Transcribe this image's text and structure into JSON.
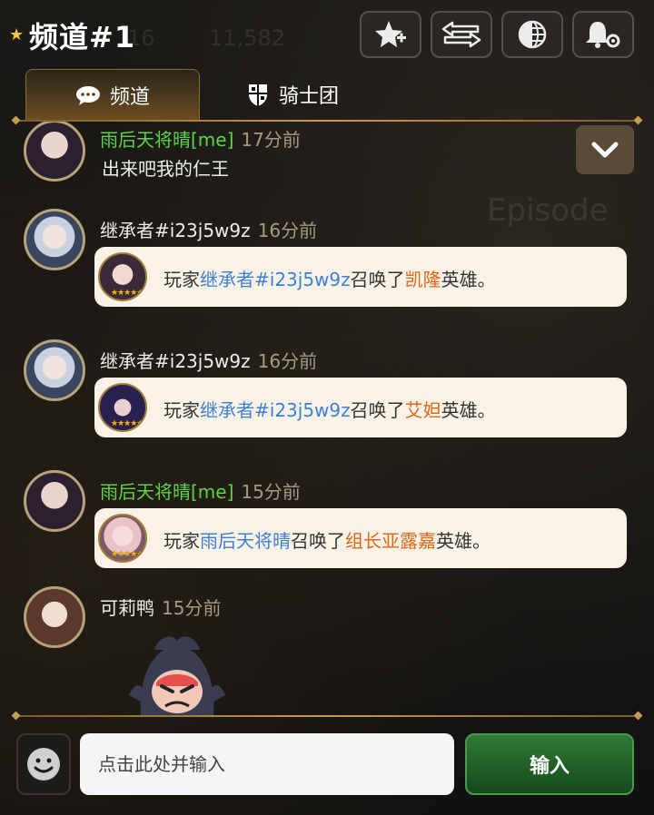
{
  "header": {
    "title": "频道#1",
    "buttons": [
      {
        "icon": "star-plus-icon"
      },
      {
        "icon": "swap-arrows-icon"
      },
      {
        "icon": "globe-icon"
      },
      {
        "icon": "bell-settings-icon"
      }
    ]
  },
  "tabs": [
    {
      "label": "频道",
      "icon": "chat-bubble-icon",
      "active": true
    },
    {
      "label": "骑士团",
      "icon": "guild-shield-icon",
      "active": false
    }
  ],
  "messages": [
    {
      "name": "雨后天将晴[me]",
      "is_me": true,
      "time": "17分前",
      "text": "出来吧我的仁王"
    },
    {
      "name": "继承者#i23j5w9z",
      "is_me": false,
      "time": "16分前",
      "card": {
        "prefix": "玩家",
        "player": "继承者#i23j5w9z",
        "middle": "召唤了",
        "hero": "凯隆",
        "suffix": "英雄。"
      }
    },
    {
      "name": "继承者#i23j5w9z",
      "is_me": false,
      "time": "16分前",
      "card": {
        "prefix": "玩家",
        "player": "继承者#i23j5w9z",
        "middle": "召唤了",
        "hero": "艾妲",
        "suffix": "英雄。"
      }
    },
    {
      "name": "雨后天将晴[me]",
      "is_me": true,
      "time": "15分前",
      "card": {
        "prefix": "玩家",
        "player": "雨后天将晴",
        "middle": "召唤了",
        "hero": "组长亚露嘉",
        "suffix": "英雄。"
      }
    },
    {
      "name": "可莉鸭",
      "is_me": false,
      "time": "15分前",
      "sticker": "angry-face-sticker"
    }
  ],
  "colors": {
    "me_name": "#5fd24a",
    "player_highlight": "#3e7fd6",
    "hero_highlight": "#e0661a",
    "accent_gold": "#c49a55",
    "send_green": "#2f7a34"
  },
  "bottom": {
    "emoji_icon": "emoji-face-icon",
    "input_placeholder": "点击此处并输入",
    "send_label": "输入"
  }
}
